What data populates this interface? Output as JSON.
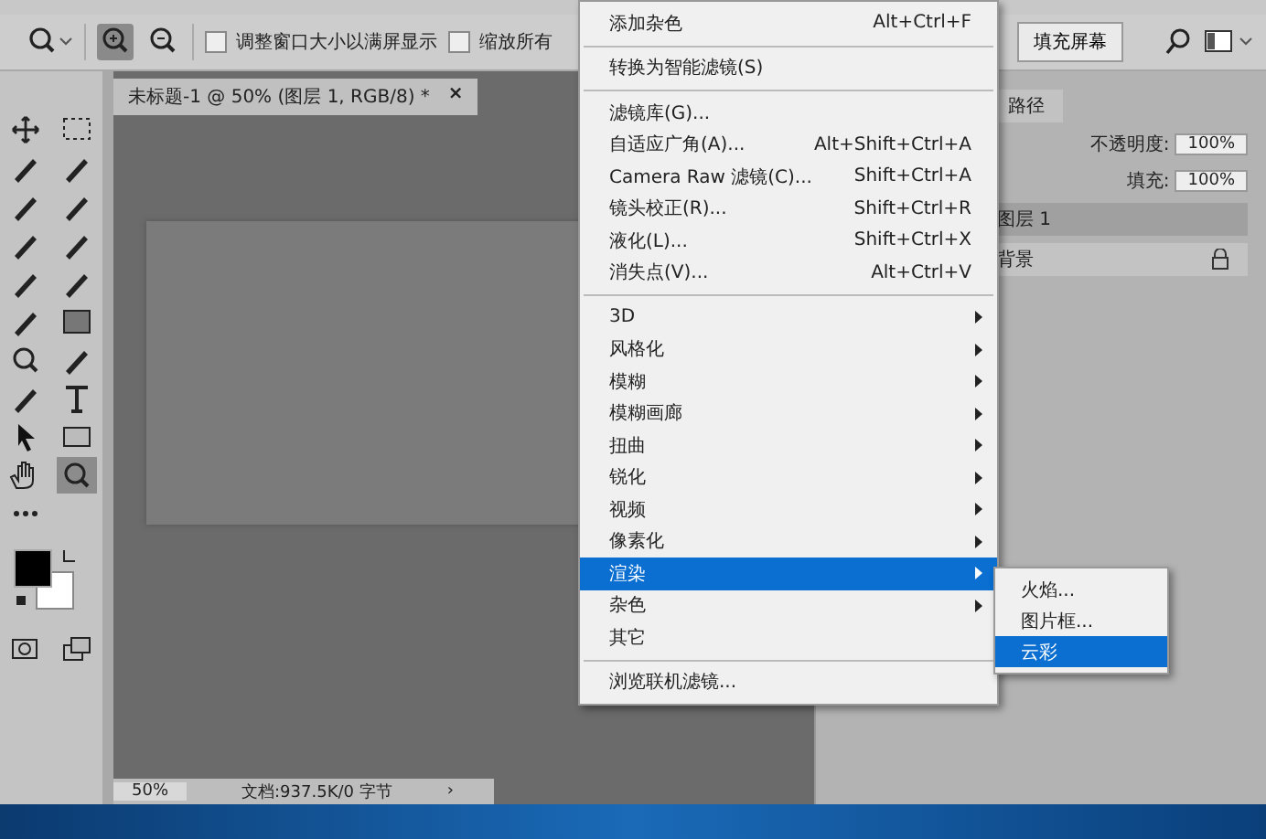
{
  "options_bar": {
    "checkboxes": [
      {
        "label": "调整窗口大小以满屏显示",
        "checked": false
      },
      {
        "label": "缩放所有",
        "checked": false
      }
    ],
    "fill_screen_button": "填充屏幕"
  },
  "document_tab": {
    "title": "未标题-1 @ 50% (图层 1, RGB/8) *",
    "close": "×"
  },
  "status_bar": {
    "zoom": "50%",
    "doc_info": "文档:937.5K/0 字节",
    "arrow": "›"
  },
  "panel": {
    "tabs": [
      {
        "label": "路径",
        "selected": false
      }
    ],
    "opacity_label": "不透明度:",
    "opacity_value": "100%",
    "fill_label": "填充:",
    "fill_value": "100%",
    "layers": [
      {
        "name": "图层 1",
        "selected": true,
        "locked": false
      },
      {
        "name": "背景",
        "selected": false,
        "locked": true
      }
    ]
  },
  "filter_menu": {
    "groups": [
      [
        {
          "label": "添加杂色",
          "shortcut": "Alt+Ctrl+F",
          "submenu": false,
          "selected": false
        }
      ],
      [
        {
          "label": "转换为智能滤镜(S)",
          "submenu": false,
          "selected": false
        }
      ],
      [
        {
          "label": "滤镜库(G)...",
          "submenu": false,
          "selected": false
        },
        {
          "label": "自适应广角(A)...",
          "shortcut": "Alt+Shift+Ctrl+A",
          "submenu": false,
          "selected": false
        },
        {
          "label": "Camera Raw 滤镜(C)...",
          "shortcut": "Shift+Ctrl+A",
          "submenu": false,
          "selected": false
        },
        {
          "label": "镜头校正(R)...",
          "shortcut": "Shift+Ctrl+R",
          "submenu": false,
          "selected": false
        },
        {
          "label": "液化(L)...",
          "shortcut": "Shift+Ctrl+X",
          "submenu": false,
          "selected": false
        },
        {
          "label": "消失点(V)...",
          "shortcut": "Alt+Ctrl+V",
          "submenu": false,
          "selected": false
        }
      ],
      [
        {
          "label": "3D",
          "submenu": true,
          "selected": false
        },
        {
          "label": "风格化",
          "submenu": true,
          "selected": false
        },
        {
          "label": "模糊",
          "submenu": true,
          "selected": false
        },
        {
          "label": "模糊画廊",
          "submenu": true,
          "selected": false
        },
        {
          "label": "扭曲",
          "submenu": true,
          "selected": false
        },
        {
          "label": "锐化",
          "submenu": true,
          "selected": false
        },
        {
          "label": "视频",
          "submenu": true,
          "selected": false
        },
        {
          "label": "像素化",
          "submenu": true,
          "selected": false
        },
        {
          "label": "渲染",
          "submenu": true,
          "selected": true
        },
        {
          "label": "杂色",
          "submenu": true,
          "selected": false
        },
        {
          "label": "其它",
          "submenu": false,
          "selected": false
        }
      ],
      [
        {
          "label": "浏览联机滤镜...",
          "submenu": false,
          "selected": false
        }
      ]
    ]
  },
  "render_submenu": [
    {
      "label": "火焰...",
      "selected": false
    },
    {
      "label": "图片框...",
      "selected": false
    },
    {
      "label": "云彩",
      "selected": true
    }
  ]
}
